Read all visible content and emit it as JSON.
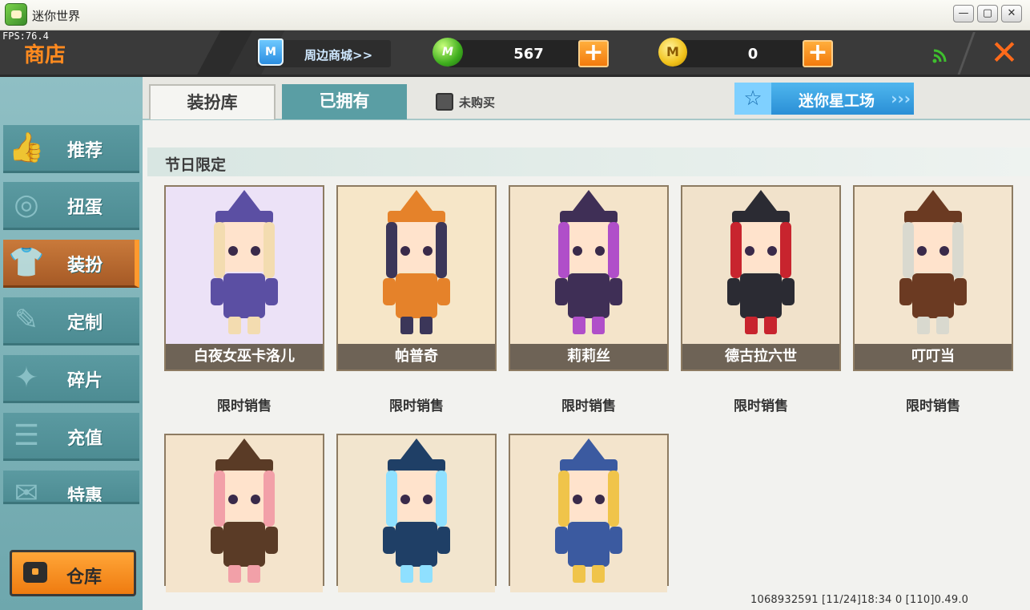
{
  "window": {
    "title": "迷你世界",
    "fps": "FPS:76.4"
  },
  "header": {
    "title": "商店",
    "mall_label": "周边商城>>",
    "mall_icon_text": "M",
    "gem": {
      "icon": "green-mini-gem-icon",
      "value": "567",
      "icon_text": "M"
    },
    "coin": {
      "icon": "gold-mini-coin-icon",
      "value": "0",
      "icon_text": "M"
    },
    "plus": "+",
    "close": "✕"
  },
  "sidebar": {
    "items": [
      {
        "label": "推荐",
        "icon": "thumbs-up-icon",
        "glyph": "👍"
      },
      {
        "label": "扭蛋",
        "icon": "capsule-icon",
        "glyph": "◎"
      },
      {
        "label": "装扮",
        "icon": "shirt-icon",
        "glyph": "👕"
      },
      {
        "label": "定制",
        "icon": "pencil-icon",
        "glyph": "✎"
      },
      {
        "label": "碎片",
        "icon": "puzzle-icon",
        "glyph": "✦"
      },
      {
        "label": "充值",
        "icon": "coins-stack-icon",
        "glyph": "☰"
      },
      {
        "label": "特惠",
        "icon": "gift-icon",
        "glyph": "✉"
      }
    ],
    "active": "装扮",
    "warehouse": "仓库"
  },
  "tabs": {
    "wardrobe": "装扮库",
    "owned": "已拥有"
  },
  "filter": {
    "label": "未购买",
    "checked": false
  },
  "studio": {
    "label": "迷你星工场",
    "icon": "star-icon",
    "arrow": "›››"
  },
  "section": {
    "title": "节日限定"
  },
  "cards": [
    {
      "name": "白夜女巫卡洛儿",
      "status": "限时销售",
      "palette": [
        "#ece2f7",
        "#5b4fa3",
        "#f3dcb0"
      ]
    },
    {
      "name": "帕普奇",
      "status": "限时销售",
      "palette": [
        "#f6e6c8",
        "#e5822a",
        "#3b3659"
      ]
    },
    {
      "name": "莉莉丝",
      "status": "限时销售",
      "palette": [
        "#f4e4ca",
        "#3f2f56",
        "#b04fc9"
      ]
    },
    {
      "name": "德古拉六世",
      "status": "限时销售",
      "palette": [
        "#f1e2cb",
        "#2b2b33",
        "#c8242e"
      ]
    },
    {
      "name": "叮叮当",
      "status": "限时销售",
      "palette": [
        "#f3e5cf",
        "#6b3a22",
        "#d9d9cf"
      ]
    },
    {
      "name": "",
      "status": "",
      "palette": [
        "#f4e4cc",
        "#5a3b26",
        "#f2a0a8"
      ]
    },
    {
      "name": "",
      "status": "",
      "palette": [
        "#f2e5ce",
        "#1f3f66",
        "#8fe0ff"
      ]
    },
    {
      "name": "",
      "status": "",
      "palette": [
        "#f3e4cc",
        "#3b5aa0",
        "#f0c44a"
      ]
    }
  ],
  "footer": {
    "info": "1068932591  [11/24]18:34 0   [110]0.49.0"
  }
}
